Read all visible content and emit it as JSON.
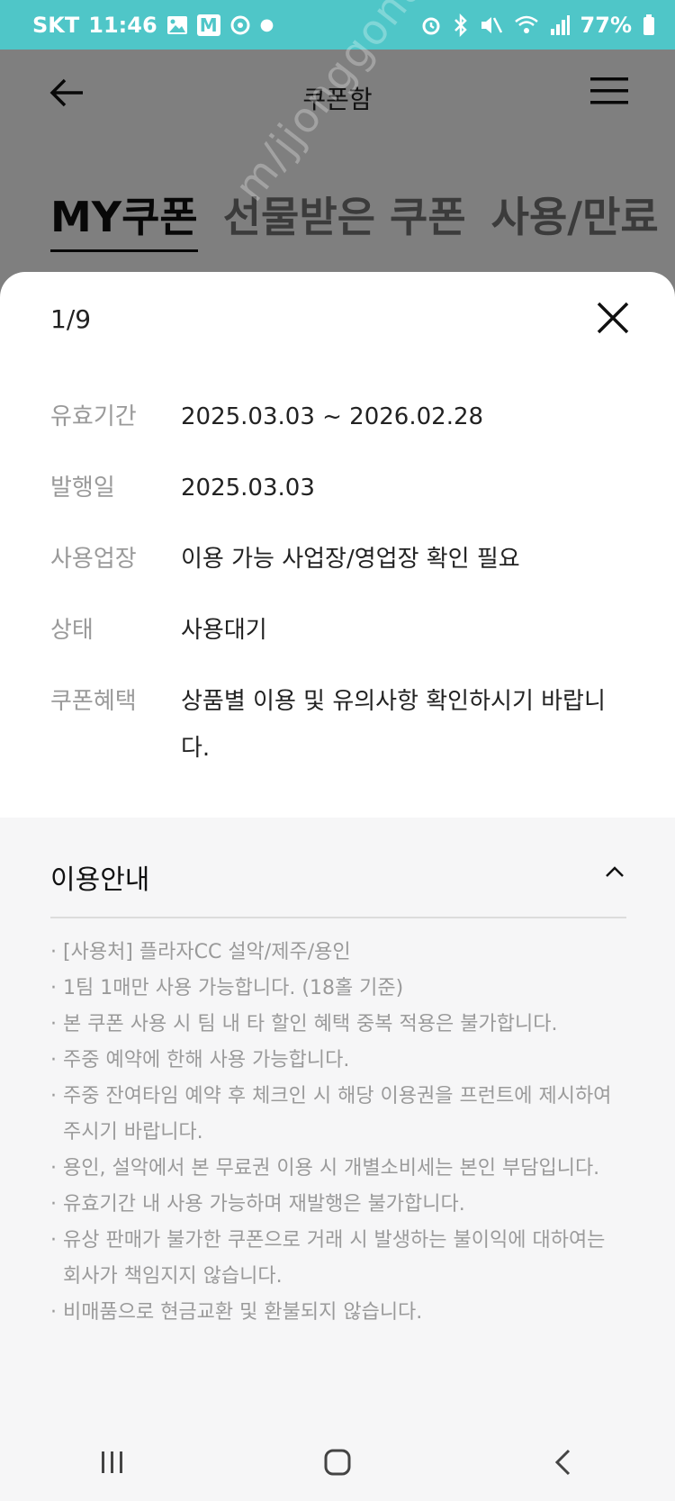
{
  "status_bar": {
    "carrier": "SKT",
    "time": "11:46",
    "battery": "77%",
    "colors": {
      "background": "#4fc6c8",
      "text": "#ffffff"
    }
  },
  "header": {
    "title": "쿠폰함",
    "back_icon": "arrow-left-icon",
    "menu_icon": "hamburger-menu-icon"
  },
  "tabs": [
    {
      "label": "MY쿠폰",
      "active": true
    },
    {
      "label": "선물받은 쿠폰",
      "active": false
    },
    {
      "label": "사용/만료",
      "active": false
    }
  ],
  "watermark": "m/jjonggonara",
  "sheet": {
    "pager": "1/9",
    "close_icon": "close-icon",
    "details": [
      {
        "label": "유효기간",
        "value": "2025.03.03 ~ 2026.02.28"
      },
      {
        "label": "발행일",
        "value": "2025.03.03"
      },
      {
        "label": "사용업장",
        "value": "이용 가능 사업장/영업장 확인 필요"
      },
      {
        "label": "상태",
        "value": "사용대기"
      },
      {
        "label": "쿠폰혜택",
        "value": "상품별 이용 및 유의사항 확인하시기 바랍니다."
      }
    ],
    "guide": {
      "title": "이용안내",
      "notes": [
        "[사용처] 플라자CC 설악/제주/용인",
        "1팀 1매만 사용 가능합니다. (18홀 기준)",
        "본 쿠폰 사용 시 팀 내 타 할인 혜택 중복 적용은 불가합니다.",
        "주중 예약에 한해 사용 가능합니다.",
        "주중 잔여타임 예약 후 체크인 시 해당 이용권을 프런트에 제시하여 주시기 바랍니다.",
        "용인, 설악에서 본 무료권 이용 시 개별소비세는 본인 부담입니다.",
        "유효기간 내 사용 가능하며 재발행은 불가합니다.",
        "유상 판매가 불가한 쿠폰으로 거래 시 발생하는 불이익에 대하여는 회사가 책임지지 않습니다.",
        "비매품으로 현금교환 및 환불되지 않습니다."
      ]
    }
  }
}
